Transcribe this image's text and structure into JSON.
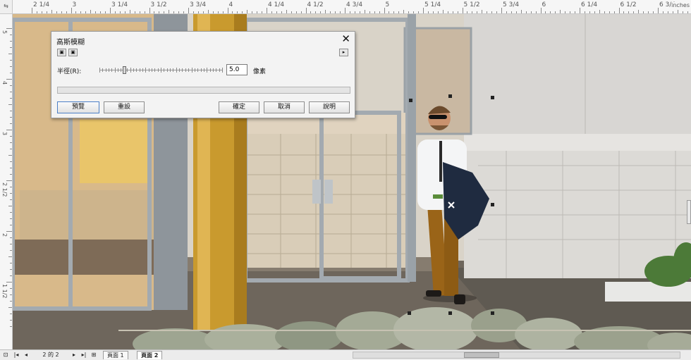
{
  "ruler": {
    "corner": "⇆",
    "units_label": "inches",
    "h_labels": [
      "2 1/4",
      "3",
      "3 1/4",
      "3 1/2",
      "3 3/4",
      "4",
      "4 1/4",
      "4 1/2",
      "4 3/4",
      "5",
      "5 1/4",
      "5 1/2",
      "5 3/4",
      "6",
      "6 1/4",
      "6 1/2",
      "6 3/4"
    ],
    "v_labels": [
      "5",
      "4",
      "3",
      "2 1/2",
      "2",
      "1 1/2"
    ]
  },
  "dialog": {
    "title": "高斯模糊",
    "close": "✕",
    "menu_arrow": "▸",
    "mini_buttons": [
      "▣",
      "▣"
    ],
    "radius_label": "半徑(R):",
    "radius_value": "5.0",
    "radius_unit": "像素",
    "slider_position": 0.2,
    "buttons": {
      "preview": "預覽",
      "reset": "重設",
      "ok": "確定",
      "cancel": "取消",
      "help": "說明"
    }
  },
  "statusbar": {
    "page_counter": "2 的 2",
    "nav_first": "|◂",
    "nav_prev": "◂",
    "nav_next": "▸",
    "nav_last": "▸|",
    "add_page": "⊞",
    "left_icon": "⊡",
    "tabs": [
      "頁面 1",
      "頁面 2"
    ],
    "active_tab": 1,
    "hscroll_position": 0.38
  },
  "colors": {
    "pillar": "#c99a2e",
    "shirt": "#f4f5f6",
    "pants": "#9a6418",
    "wall": "#d7d5d2",
    "accent": "#4c7fc6"
  }
}
